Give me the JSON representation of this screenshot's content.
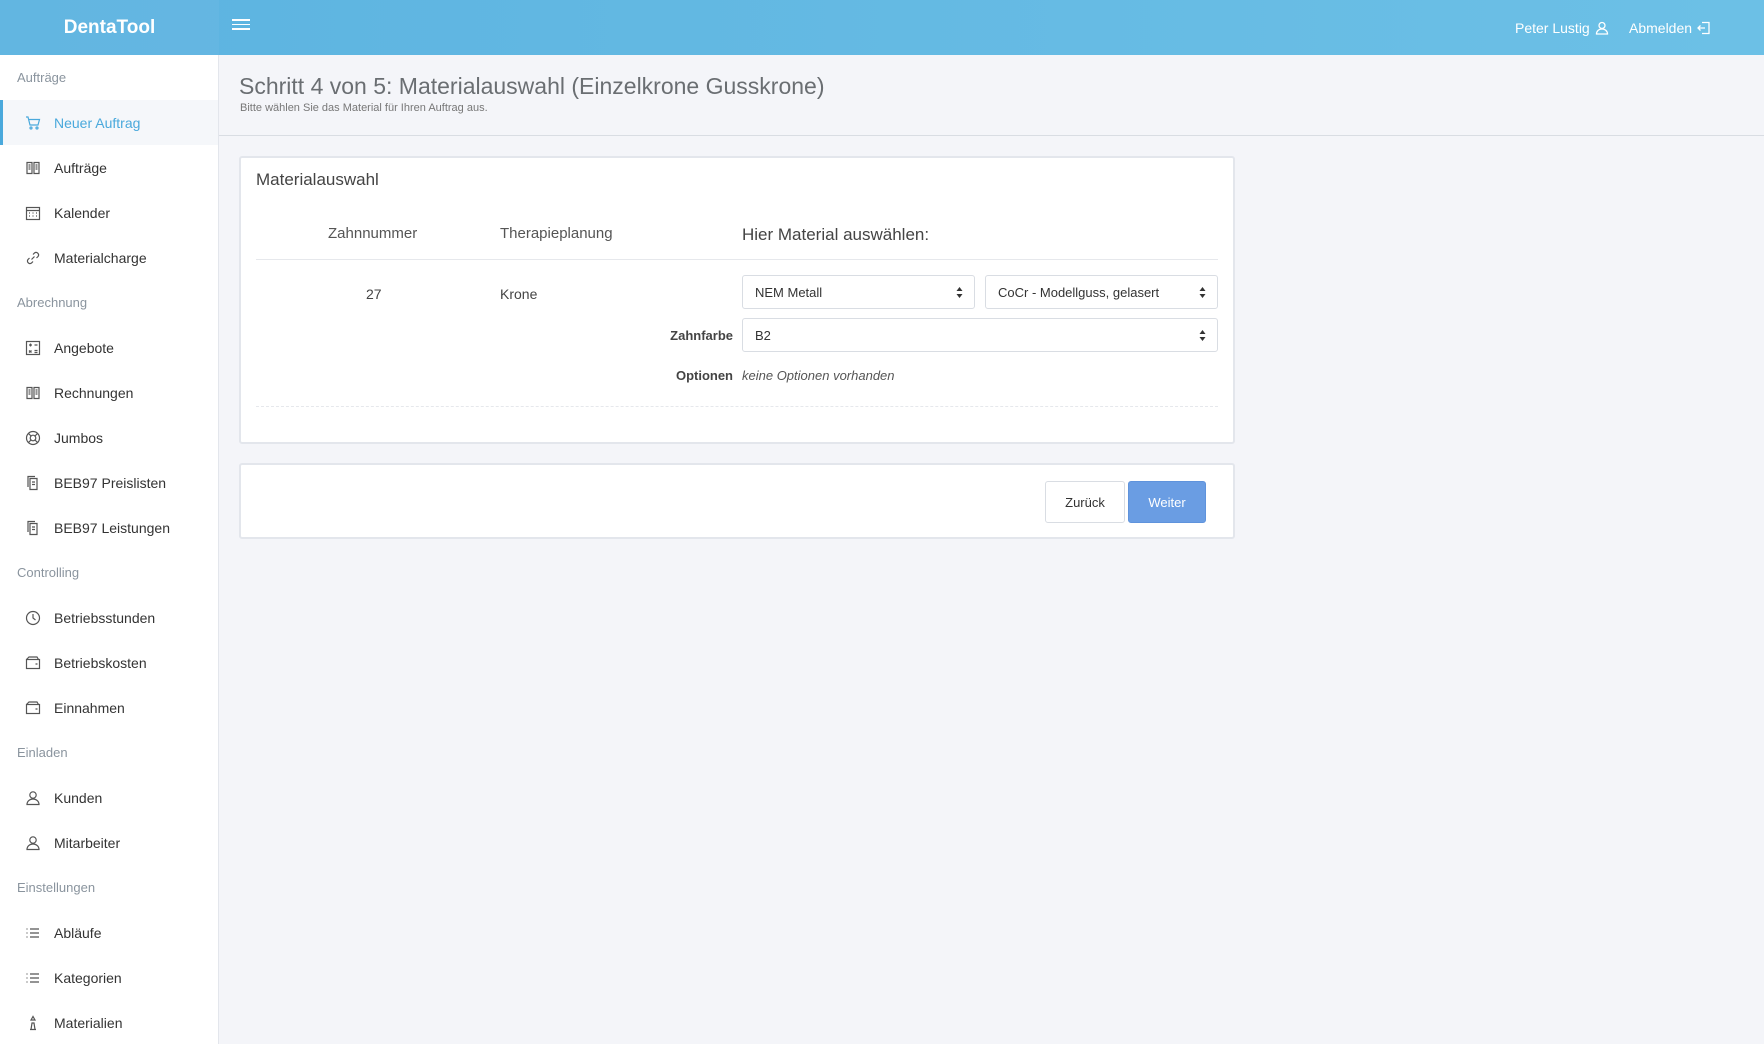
{
  "app": {
    "brand": "DentaTool"
  },
  "topbar": {
    "user_name": "Peter Lustig",
    "logout_label": "Abmelden"
  },
  "sidebar": {
    "sections": [
      {
        "title": "Aufträge",
        "items": [
          {
            "label": "Neuer Auftrag",
            "icon": "cart-icon",
            "active": true
          },
          {
            "label": "Aufträge",
            "icon": "book-icon"
          },
          {
            "label": "Kalender",
            "icon": "calendar-icon"
          },
          {
            "label": "Materialcharge",
            "icon": "link-icon"
          }
        ]
      },
      {
        "title": "Abrechnung",
        "items": [
          {
            "label": "Angebote",
            "icon": "calculator-icon"
          },
          {
            "label": "Rechnungen",
            "icon": "book-icon"
          },
          {
            "label": "Jumbos",
            "icon": "lifebuoy-icon"
          },
          {
            "label": "BEB97 Preislisten",
            "icon": "documents-icon"
          },
          {
            "label": "BEB97 Leistungen",
            "icon": "documents-icon"
          }
        ]
      },
      {
        "title": "Controlling",
        "items": [
          {
            "label": "Betriebsstunden",
            "icon": "clock-icon"
          },
          {
            "label": "Betriebskosten",
            "icon": "wallet-icon"
          },
          {
            "label": "Einnahmen",
            "icon": "wallet-icon"
          }
        ]
      },
      {
        "title": "Einladen",
        "items": [
          {
            "label": "Kunden",
            "icon": "user-icon"
          },
          {
            "label": "Mitarbeiter",
            "icon": "user-icon"
          }
        ]
      },
      {
        "title": "Einstellungen",
        "items": [
          {
            "label": "Abläufe",
            "icon": "list-icon"
          },
          {
            "label": "Kategorien",
            "icon": "list-icon"
          },
          {
            "label": "Materialien",
            "icon": "chess-icon"
          }
        ]
      }
    ]
  },
  "page": {
    "title": "Schritt 4 von 5: Materialauswahl (Einzelkrone Gusskrone)",
    "subtitle": "Bitte wählen Sie das Material für Ihren Auftrag aus."
  },
  "material_panel": {
    "title": "Materialauswahl",
    "columns": {
      "tooth": "Zahnnummer",
      "therapy": "Therapieplanung",
      "material": "Hier Material auswählen:"
    },
    "row": {
      "tooth": "27",
      "therapy": "Krone",
      "material_group": "NEM Metall",
      "material": "CoCr - Modellguss, gelasert",
      "shade_label": "Zahnfarbe",
      "shade": "B2",
      "options_label": "Optionen",
      "options_value": "keine Optionen vorhanden"
    }
  },
  "actions": {
    "back": "Zurück",
    "next": "Weiter"
  },
  "colors": {
    "topbar": "#5cb3e0",
    "accent": "#4aa9dc",
    "primary_button": "#6a9de3"
  }
}
